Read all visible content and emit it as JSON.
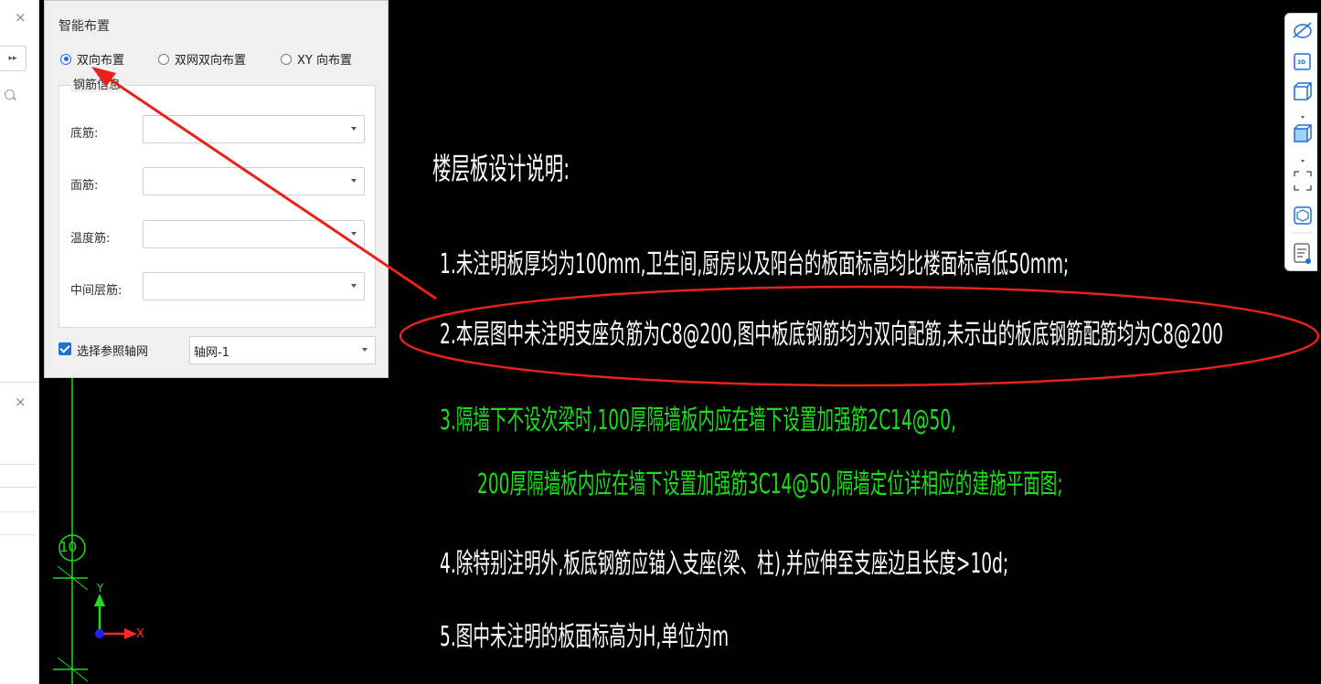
{
  "left_pane": {
    "close_glyph": "×",
    "expand_glyph": "▸▸"
  },
  "panel": {
    "title": "智能布置",
    "radio_options": [
      "双向布置",
      "双网双向布置",
      "XY 向布置"
    ],
    "selected_index": 0,
    "group_title": "钢筋信息",
    "fields": [
      {
        "label": "底筋:",
        "value": ""
      },
      {
        "label": "面筋:",
        "value": ""
      },
      {
        "label": "温度筋:",
        "value": ""
      },
      {
        "label": "中间层筋:",
        "value": ""
      }
    ],
    "checkbox_label": "选择参照轴网",
    "checkbox_checked": true,
    "grid_select_value": "轴网-1"
  },
  "drawing": {
    "title": "楼层板设计说明:",
    "note1": "1.未注明板厚均为100mm,卫生间,厨房以及阳台的板面标高均比楼面标高低50mm;",
    "note2": "2.本层图中未注明支座负筋为C8@200,图中板底钢筋均为双向配筋,未示出的板底钢筋配筋均为C8@200",
    "note3a": "3.隔墙下不设次梁时,100厚隔墙板内应在墙下设置加强筋2C14@50,",
    "note3b": "200厚隔墙板内应在墙下设置加强筋3C14@50,隔墙定位详相应的建施平面图;",
    "note4": "4.除特别注明外,板底钢筋应锚入支座(梁、柱),并应伸至支座边且长度>10d;",
    "note5": "5.图中未注明的板面标高为H,单位为m",
    "axis_number": "10",
    "ucs_x": "X",
    "ucs_y": "Y"
  },
  "toolbar": {
    "icons": [
      "orbit-icon",
      "3d-view-icon",
      "box-view-icon",
      "shaded-box-icon",
      "fit-window-icon",
      "model-cube-icon",
      "properties-icon"
    ],
    "badge_3d": "3D"
  },
  "colors": {
    "annotation_red": "#e8211a",
    "green_text": "#19e019",
    "accent_blue": "#1e6fd9"
  }
}
